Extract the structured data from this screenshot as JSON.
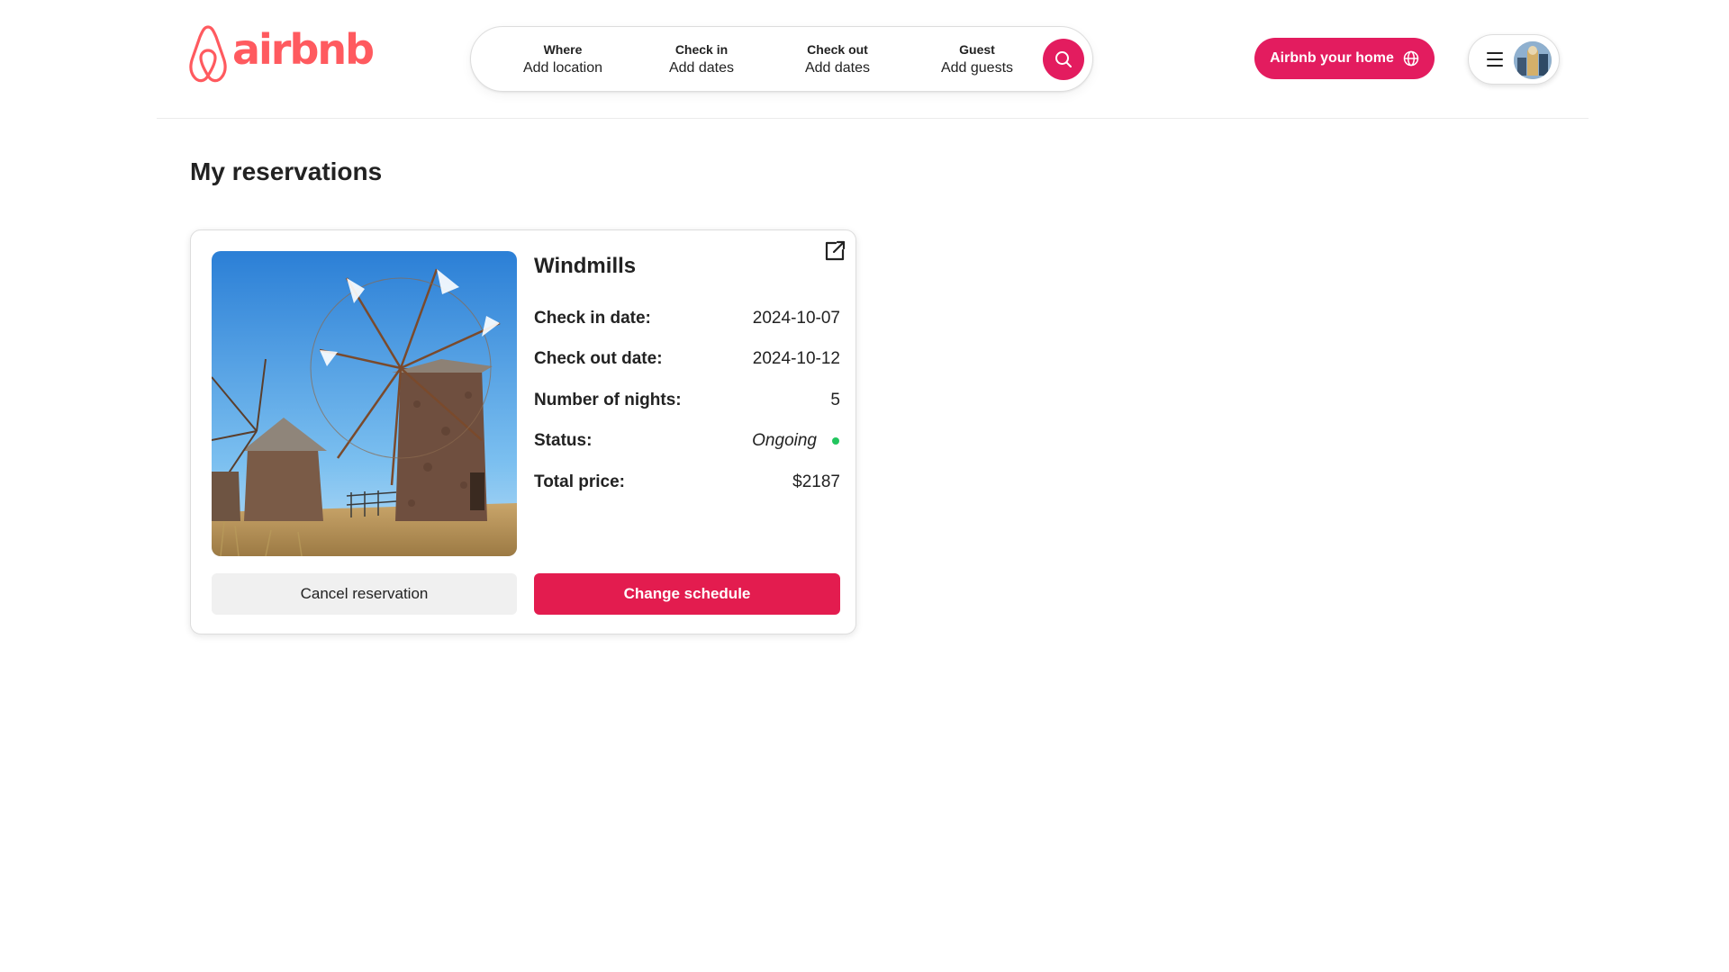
{
  "brand": {
    "name": "airbnb",
    "color": "#ff5a5f",
    "icon": "airbnb-logo-icon"
  },
  "search": {
    "where": {
      "title": "Where",
      "value": "Add location"
    },
    "check_in": {
      "title": "Check in",
      "value": "Add dates"
    },
    "check_out": {
      "title": "Check out",
      "value": "Add dates"
    },
    "guest": {
      "title": "Guest",
      "value": "Add guests"
    },
    "button_icon": "search-icon",
    "button_color": "#e31c5f"
  },
  "header": {
    "host_button_label": "Airbnb your home",
    "host_button_icon": "globe-icon",
    "menu_icon": "hamburger-icon",
    "avatar_icon": "user-avatar"
  },
  "page": {
    "title": "My reservations"
  },
  "reservation": {
    "name": "Windmills",
    "image": "windmills-photo",
    "open_icon": "external-link-icon",
    "rows": [
      {
        "label": "Check in date:",
        "value": "2024-10-07"
      },
      {
        "label": "Check out date:",
        "value": "2024-10-12"
      },
      {
        "label": "Number of nights:",
        "value": "5"
      },
      {
        "label": "Status:",
        "value": "Ongoing",
        "status_color": "#22c55e"
      },
      {
        "label": "Total price:",
        "value": "$2187"
      }
    ],
    "cancel_label": "Cancel reservation",
    "change_label": "Change schedule",
    "accent_color": "#e31c4f"
  }
}
